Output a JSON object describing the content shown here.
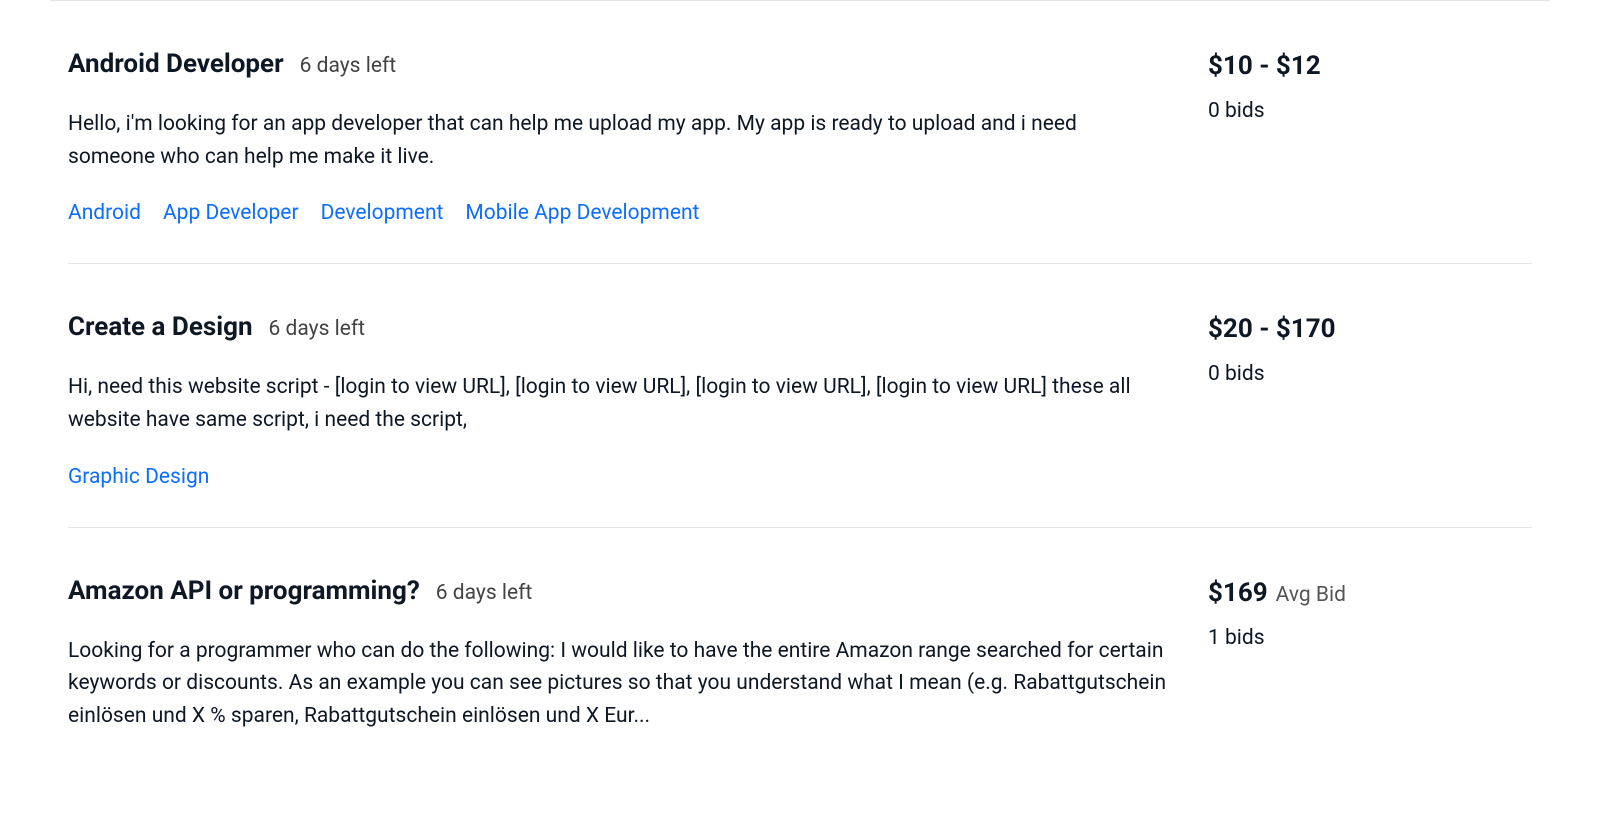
{
  "jobs": [
    {
      "title": "Android Developer",
      "time_left": "6 days left",
      "description": "Hello, i'm looking for an app developer that can help me upload my app. My app is ready to upload and i need someone who can help me make it live.",
      "tags": [
        "Android",
        "App Developer",
        "Development",
        "Mobile App Development"
      ],
      "price": "$10 - $12",
      "price_suffix": "",
      "bids": "0 bids"
    },
    {
      "title": "Create a Design",
      "time_left": "6 days left",
      "description": "Hi, need this website script - [login to view URL], [login to view URL], [login to view URL], [login to view URL] these all website have same script, i need the script,",
      "tags": [
        "Graphic Design"
      ],
      "price": "$20 - $170",
      "price_suffix": "",
      "bids": "0 bids"
    },
    {
      "title": "Amazon API or programming?",
      "time_left": "6 days left",
      "description": "Looking for a programmer who can do the following: I would like to have the entire Amazon range searched for certain keywords or discounts. As an example you can see pictures so that you understand what I mean (e.g. Rabattgutschein einlösen und X % sparen, Rabattgutschein einlösen und X Eur...",
      "tags": [],
      "price": "$169",
      "price_suffix": "Avg Bid",
      "bids": "1 bids"
    }
  ]
}
